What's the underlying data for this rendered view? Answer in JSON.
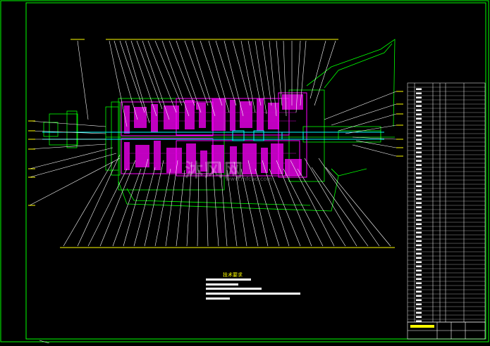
{
  "drawing": {
    "tech_requirements_title": "技术要求",
    "watermark_brand": "沐风网",
    "watermark_url": "www.mfcad.com"
  },
  "colors": {
    "background": "#000000",
    "frame": "#00ff00",
    "section_hatch": "#ff00ff",
    "leader_lines": "#ffffff",
    "annotation": "#ffff00",
    "shaft": "#00ffff"
  }
}
